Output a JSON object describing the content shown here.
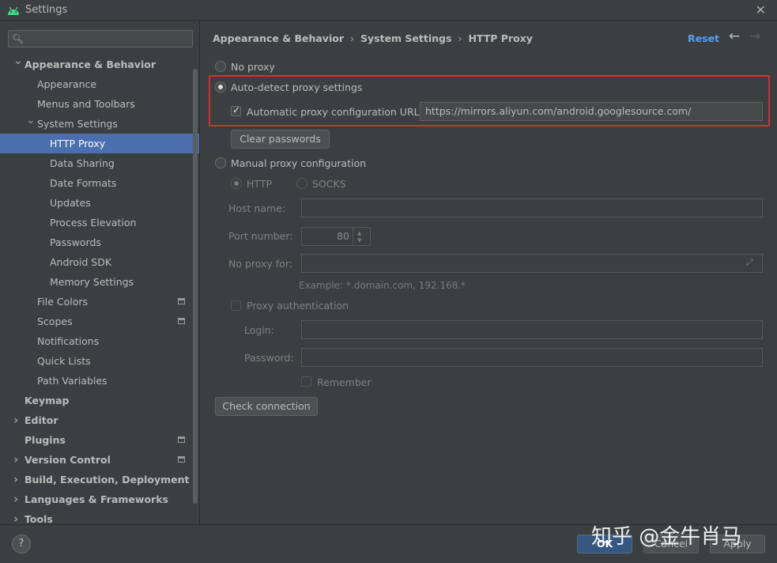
{
  "window": {
    "title": "Settings"
  },
  "sidebar": {
    "search_placeholder": "",
    "items": [
      {
        "label": "Appearance & Behavior",
        "level": 0,
        "bold": true,
        "arrow": "down"
      },
      {
        "label": "Appearance",
        "level": 1
      },
      {
        "label": "Menus and Toolbars",
        "level": 1
      },
      {
        "label": "System Settings",
        "level": 1,
        "arrow": "down"
      },
      {
        "label": "HTTP Proxy",
        "level": 2,
        "selected": true
      },
      {
        "label": "Data Sharing",
        "level": 2
      },
      {
        "label": "Date Formats",
        "level": 2
      },
      {
        "label": "Updates",
        "level": 2
      },
      {
        "label": "Process Elevation",
        "level": 2
      },
      {
        "label": "Passwords",
        "level": 2
      },
      {
        "label": "Android SDK",
        "level": 2
      },
      {
        "label": "Memory Settings",
        "level": 2
      },
      {
        "label": "File Colors",
        "level": 1,
        "project": true
      },
      {
        "label": "Scopes",
        "level": 1,
        "project": true
      },
      {
        "label": "Notifications",
        "level": 1
      },
      {
        "label": "Quick Lists",
        "level": 1
      },
      {
        "label": "Path Variables",
        "level": 1
      },
      {
        "label": "Keymap",
        "level": 0,
        "bold": true
      },
      {
        "label": "Editor",
        "level": 0,
        "bold": true,
        "arrow": "right"
      },
      {
        "label": "Plugins",
        "level": 0,
        "bold": true,
        "project": true
      },
      {
        "label": "Version Control",
        "level": 0,
        "bold": true,
        "arrow": "right",
        "project": true
      },
      {
        "label": "Build, Execution, Deployment",
        "level": 0,
        "bold": true,
        "arrow": "right"
      },
      {
        "label": "Languages & Frameworks",
        "level": 0,
        "bold": true,
        "arrow": "right"
      },
      {
        "label": "Tools",
        "level": 0,
        "bold": true,
        "arrow": "right"
      }
    ]
  },
  "header": {
    "breadcrumb": [
      "Appearance & Behavior",
      "System Settings",
      "HTTP Proxy"
    ],
    "reset_label": "Reset"
  },
  "proxy": {
    "no_proxy_label": "No proxy",
    "auto_detect_label": "Auto-detect proxy settings",
    "auto_config_url_label": "Automatic proxy configuration URL:",
    "auto_config_url_value": "https://mirrors.aliyun.com/android.googlesource.com/",
    "clear_passwords_label": "Clear passwords",
    "manual_label": "Manual proxy configuration",
    "http_label": "HTTP",
    "socks_label": "SOCKS",
    "host_name_label": "Host name:",
    "host_name_value": "",
    "port_number_label": "Port number:",
    "port_number_value": "80",
    "no_proxy_for_label": "No proxy for:",
    "no_proxy_for_value": "",
    "example_text": "Example: *.domain.com, 192.168.*",
    "proxy_auth_label": "Proxy authentication",
    "login_label": "Login:",
    "password_label": "Password:",
    "remember_label": "Remember",
    "check_connection_label": "Check connection"
  },
  "footer": {
    "help_label": "?",
    "ok_label": "OK",
    "cancel_label": "Cancel",
    "apply_label": "Apply",
    "watermark": "知乎 @金牛肖马"
  },
  "colors": {
    "accent": "#4b6eaf",
    "link": "#589df6",
    "highlight_box": "#e0292b"
  }
}
